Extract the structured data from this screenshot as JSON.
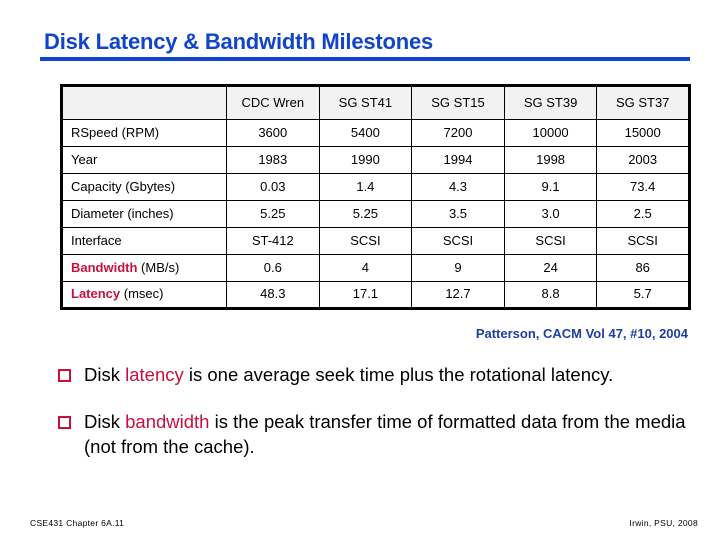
{
  "slide": {
    "title": "Disk Latency & Bandwidth Milestones",
    "attribution": "Patterson, CACM Vol 47, #10, 2004"
  },
  "table": {
    "corner_label": "",
    "columns": [
      "CDC Wren",
      "SG ST41",
      "SG ST15",
      "SG ST39",
      "SG ST37"
    ],
    "rows": [
      {
        "label": "RSpeed (RPM)",
        "accent_term": "",
        "unit_text": "",
        "values": [
          "3600",
          "5400",
          "7200",
          "10000",
          "15000"
        ]
      },
      {
        "label": "Year",
        "accent_term": "",
        "unit_text": "",
        "values": [
          "1983",
          "1990",
          "1994",
          "1998",
          "2003"
        ]
      },
      {
        "label": "Capacity (Gbytes)",
        "accent_term": "",
        "unit_text": "",
        "values": [
          "0.03",
          "1.4",
          "4.3",
          "9.1",
          "73.4"
        ]
      },
      {
        "label": "Diameter (inches)",
        "accent_term": "",
        "unit_text": "",
        "values": [
          "5.25",
          "5.25",
          "3.5",
          "3.0",
          "2.5"
        ]
      },
      {
        "label": "Interface",
        "accent_term": "",
        "unit_text": "",
        "values": [
          "ST-412",
          "SCSI",
          "SCSI",
          "SCSI",
          "SCSI"
        ]
      },
      {
        "label": "Bandwidth (MB/s)",
        "accent_term": "Bandwidth",
        "unit_text": " (MB/s)",
        "values": [
          "0.6",
          "4",
          "9",
          "24",
          "86"
        ]
      },
      {
        "label": "Latency (msec)",
        "accent_term": "Latency",
        "unit_text": " (msec)",
        "values": [
          "48.3",
          "17.1",
          "12.7",
          "8.8",
          "5.7"
        ]
      }
    ]
  },
  "bullets": [
    {
      "marker": "hollow-square-bullet",
      "lead": "Disk ",
      "term": "latency",
      "rest": " is one average seek time plus the rotational latency."
    },
    {
      "marker": "hollow-square-bullet",
      "lead": "Disk ",
      "term": "bandwidth",
      "rest": " is the peak transfer time of formatted data from the media (not from the cache)."
    }
  ],
  "footer": {
    "left": "CSE431  Chapter 6A.11",
    "right": "Irwin, PSU, 2008"
  },
  "colors": {
    "title_blue": "#1144cc",
    "attribution_blue": "#1f3fa0",
    "accent_crimson": "#c8103e",
    "header_fill": "#f2f2f2",
    "border": "#000000"
  }
}
